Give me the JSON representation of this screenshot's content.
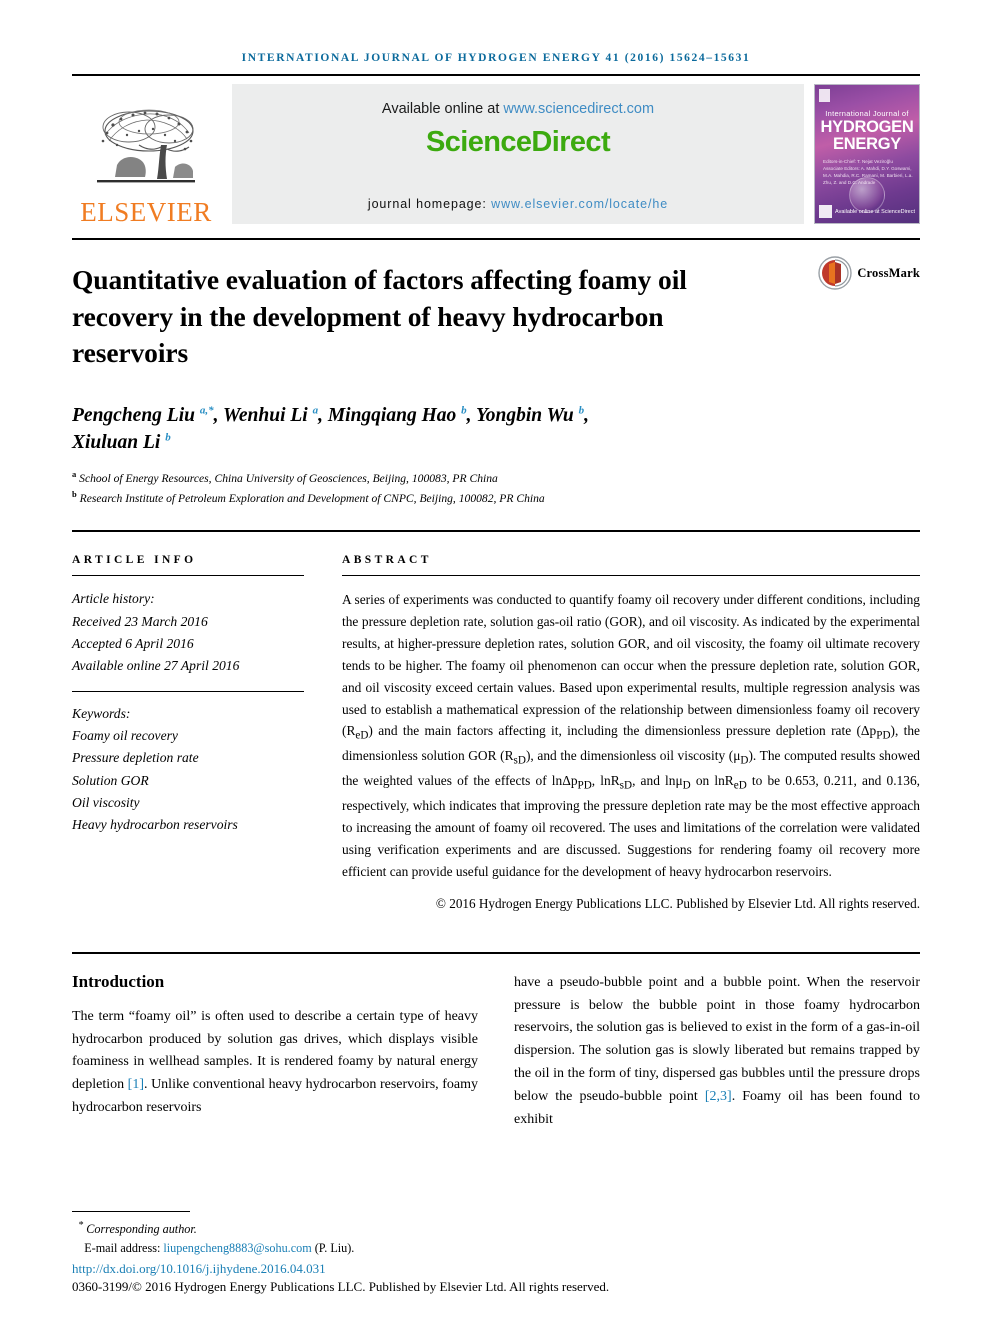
{
  "running_head": "International Journal of Hydrogen Energy 41 (2016) 15624–15631",
  "masthead": {
    "publisher_name": "ELSEVIER",
    "available_prefix": "Available online at ",
    "available_link": "www.sciencedirect.com",
    "sciencedirect_logo": "ScienceDirect",
    "homepage_prefix": "journal homepage: ",
    "homepage_link": "www.elsevier.com/locate/he",
    "cover": {
      "line1": "International Journal of",
      "line2": "HYDROGEN",
      "line3": "ENERGY",
      "editors": "Editors-in-Chief: T. Nejat Veziroğlu   Associate Editors: A. Mahdi, D.Y. Goswami, M.A. Mahdia, R.C. Ramani, M. Barbieri, L.a. Zhu, Z. and D.C. Andrade",
      "footer": "Available online at ScienceDirect"
    }
  },
  "article": {
    "title": "Quantitative evaluation of factors affecting foamy oil recovery in the development of heavy hydrocarbon reservoirs",
    "crossmark_label": "CrossMark",
    "authors_line1_part1": "Pengcheng Liu ",
    "authors_line1_sup1": "a,*",
    "authors_line1_part2": ", Wenhui Li ",
    "authors_line1_sup2": "a",
    "authors_line1_part3": ", Mingqiang Hao ",
    "authors_line1_sup3": "b",
    "authors_line1_part4": ", Yongbin Wu ",
    "authors_line1_sup4": "b",
    "authors_line1_part5": ",",
    "authors_line2_part1": "Xiuluan Li ",
    "authors_line2_sup1": "b",
    "affiliation_a_sup": "a",
    "affiliation_a": " School of Energy Resources, China University of Geosciences, Beijing, 100083, PR China",
    "affiliation_b_sup": "b",
    "affiliation_b": " Research Institute of Petroleum Exploration and Development of CNPC, Beijing, 100082, PR China"
  },
  "article_info": {
    "heading": "Article info",
    "history_label": "Article history:",
    "received": "Received 23 March 2016",
    "accepted": "Accepted 6 April 2016",
    "available_online": "Available online 27 April 2016",
    "keywords_label": "Keywords:",
    "keywords": [
      "Foamy oil recovery",
      "Pressure depletion rate",
      "Solution GOR",
      "Oil viscosity",
      "Heavy hydrocarbon reservoirs"
    ]
  },
  "abstract": {
    "heading": "Abstract",
    "part1": "A series of experiments was conducted to quantify foamy oil recovery under different conditions, including the pressure depletion rate, solution gas-oil ratio (GOR), and oil viscosity. As indicated by the experimental results, at higher-pressure depletion rates, solution GOR, and oil viscosity, the foamy oil ultimate recovery tends to be higher. The foamy oil phenomenon can occur when the pressure depletion rate, solution GOR, and oil viscosity exceed certain values. Based upon experimental results, multiple regression analysis was used to establish a mathematical expression of the relationship between dimensionless foamy oil recovery (R",
    "sub1": "eD",
    "part2": ") and the main factors affecting it, including the dimensionless pressure depletion rate (Δp",
    "sub2": "PD",
    "part3": "), the dimensionless solution GOR (R",
    "sub3": "sD",
    "part4": "), and the dimensionless oil viscosity (μ",
    "sub4": "D",
    "part5": "). The computed results showed the weighted values of the effects of lnΔp",
    "sub5": "PD",
    "part6": ", lnR",
    "sub6": "sD",
    "part7": ", and lnμ",
    "sub7": "D",
    "part8": " on lnR",
    "sub8": "eD",
    "part9": " to be 0.653, 0.211, and 0.136, respectively, which indicates that improving the pressure depletion rate may be the most effective approach to increasing the amount of foamy oil recovered. The uses and limitations of the correlation were validated using verification experiments and are discussed. Suggestions for rendering foamy oil recovery more efficient can provide useful guidance for the development of heavy hydrocarbon reservoirs.",
    "copyright": "© 2016 Hydrogen Energy Publications LLC. Published by Elsevier Ltd. All rights reserved."
  },
  "body": {
    "introduction_heading": "Introduction",
    "left_part1": "The term “foamy oil” is often used to describe a certain type of heavy hydrocarbon produced by solution gas drives, which displays visible foaminess in wellhead samples. It is rendered foamy by natural energy depletion ",
    "left_ref1": "[1]",
    "left_part2": ". Unlike conventional heavy hydrocarbon reservoirs, foamy hydrocarbon reservoirs",
    "right_part1": "have a pseudo-bubble point and a bubble point. When the reservoir pressure is below the bubble point in those foamy hydrocarbon reservoirs, the solution gas is believed to exist in the form of a gas-in-oil dispersion. The solution gas is slowly liberated but remains trapped by the oil in the form of tiny, dispersed gas bubbles until the pressure drops below the pseudo-bubble point ",
    "right_ref1": "[2,3]",
    "right_part2": ". Foamy oil has been found to exhibit"
  },
  "footer": {
    "corresponding_marker": "*",
    "corresponding_label": " Corresponding author.",
    "email_label": "E-mail address: ",
    "email": "liupengcheng8883@sohu.com",
    "email_suffix": " (P. Liu).",
    "doi": "http://dx.doi.org/10.1016/j.ijhydene.2016.04.031",
    "issn_line": "0360-3199/© 2016 Hydrogen Energy Publications LLC. Published by Elsevier Ltd. All rights reserved."
  },
  "colors": {
    "running_head": "#0b6a9c",
    "link": "#1a7fb5",
    "sciencedirect_green": "#3caa0f",
    "elsevier_orange": "#f07c22",
    "superscript_blue": "#2a8fc4"
  }
}
